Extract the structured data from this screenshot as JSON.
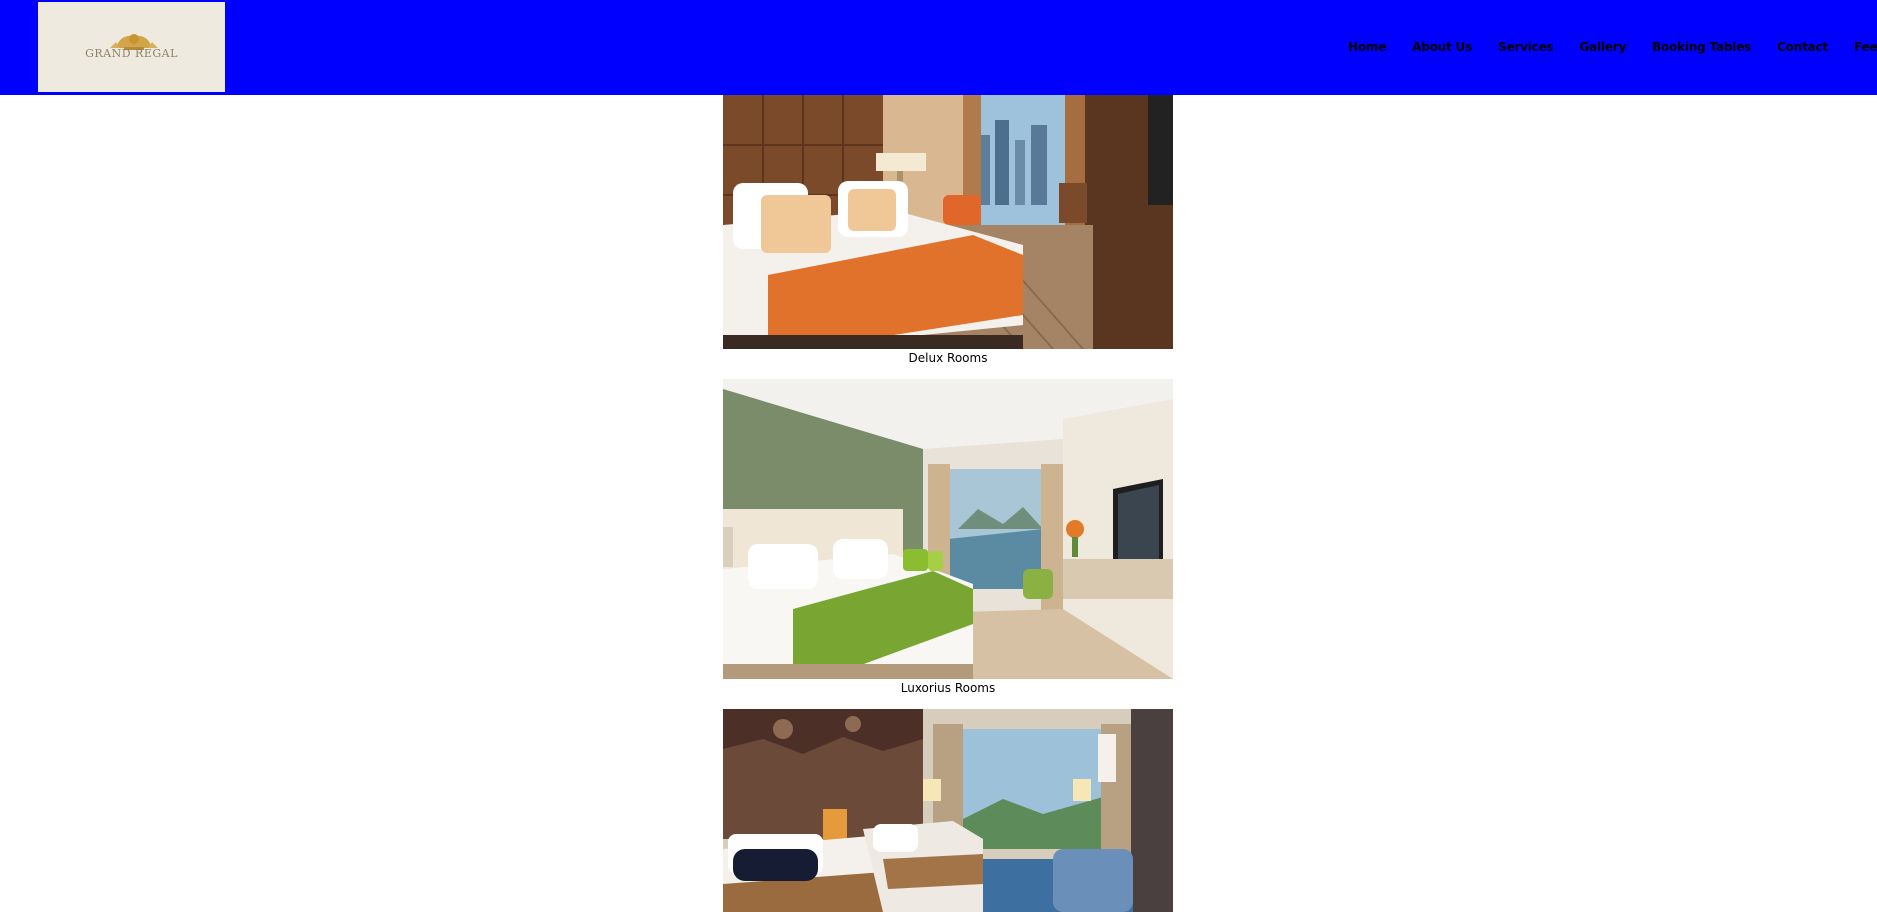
{
  "brand": {
    "logo_text": "GRAND REGAL",
    "color": "#0000ff"
  },
  "nav": {
    "items": [
      "Home",
      "About Us",
      "Services",
      "Gallery",
      "Booking Tables",
      "Contact",
      "Feedback"
    ]
  },
  "gallery": {
    "rooms": [
      {
        "caption": "Delux Rooms",
        "photo": "deluxe-room-orange-bed"
      },
      {
        "caption": "Luxorius Rooms",
        "photo": "luxury-room-green-bed"
      },
      {
        "caption": "",
        "photo": "suite-room-twin-beds"
      }
    ]
  }
}
